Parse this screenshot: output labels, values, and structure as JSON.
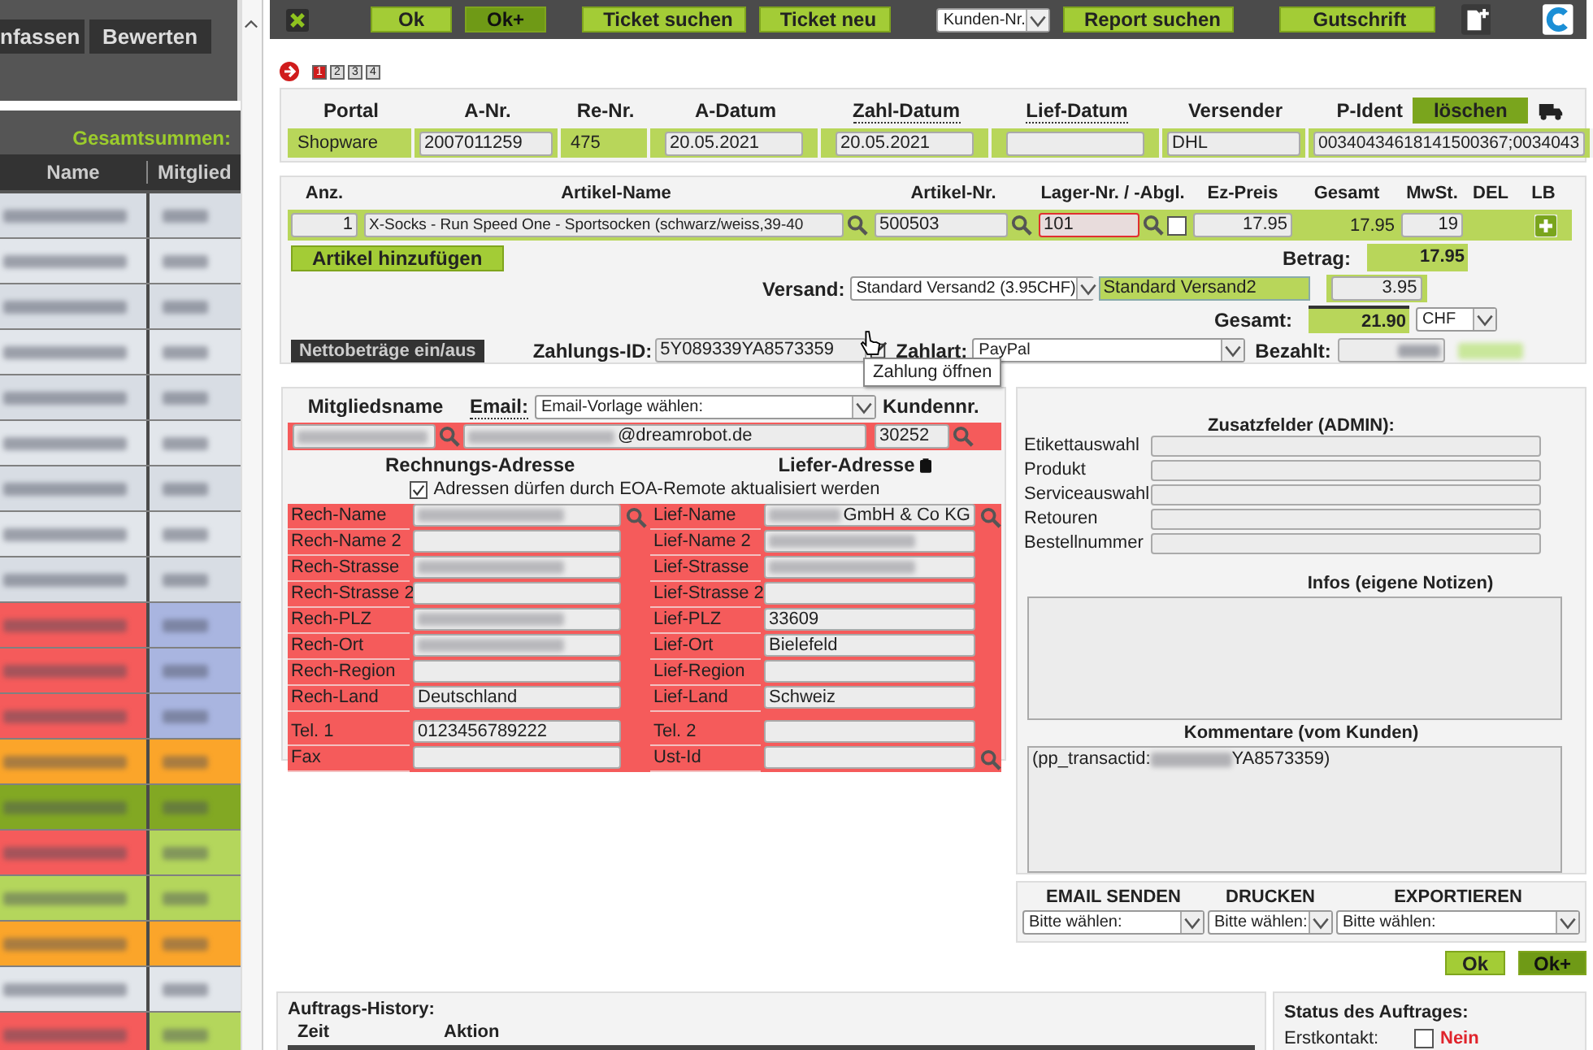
{
  "sidebar": {
    "tabs": [
      {
        "label": "nfassen",
        "selected": false
      },
      {
        "label": "Bewerten",
        "selected": false
      }
    ],
    "summary_label": "Gesamtsummen:",
    "columns": [
      "Name",
      "Mitglied"
    ],
    "rows": [
      {
        "cells": [
          {
            "color": "#d8dde4"
          },
          {
            "color": "#d8dde4"
          }
        ]
      },
      {
        "cells": [
          {
            "color": "#e2e6eb"
          },
          {
            "color": "#e2e6eb"
          }
        ]
      },
      {
        "cells": [
          {
            "color": "#d8dde4"
          },
          {
            "color": "#d8dde4"
          }
        ]
      },
      {
        "cells": [
          {
            "color": "#e2e6eb"
          },
          {
            "color": "#e2e6eb"
          }
        ]
      },
      {
        "cells": [
          {
            "color": "#d8dde4"
          },
          {
            "color": "#d8dde4"
          }
        ]
      },
      {
        "cells": [
          {
            "color": "#e2e6eb"
          },
          {
            "color": "#e2e6eb"
          }
        ]
      },
      {
        "cells": [
          {
            "color": "#d8dde4"
          },
          {
            "color": "#d8dde4"
          }
        ]
      },
      {
        "cells": [
          {
            "color": "#e2e6eb"
          },
          {
            "color": "#e2e6eb"
          }
        ]
      },
      {
        "cells": [
          {
            "color": "#d8dde4"
          },
          {
            "color": "#d8dde4"
          }
        ]
      },
      {
        "cells": [
          {
            "color": "#f55b5b"
          },
          {
            "color": "#a9b5e0"
          }
        ]
      },
      {
        "cells": [
          {
            "color": "#f55b5b"
          },
          {
            "color": "#a9b5e0"
          }
        ]
      },
      {
        "cells": [
          {
            "color": "#f55b5b"
          },
          {
            "color": "#a9b5e0"
          }
        ]
      },
      {
        "cells": [
          {
            "color": "#fba52a"
          },
          {
            "color": "#fba52a"
          }
        ]
      },
      {
        "cells": [
          {
            "color": "#82a823"
          },
          {
            "color": "#82a823"
          }
        ]
      },
      {
        "cells": [
          {
            "color": "#f55b5b"
          },
          {
            "color": "#b4d65c"
          }
        ]
      },
      {
        "cells": [
          {
            "color": "#b4d65c"
          },
          {
            "color": "#b4d65c"
          }
        ]
      },
      {
        "cells": [
          {
            "color": "#fba52a"
          },
          {
            "color": "#fba52a"
          }
        ]
      },
      {
        "cells": [
          {
            "color": "#e2e6eb"
          },
          {
            "color": "#e2e6eb"
          }
        ]
      },
      {
        "cells": [
          {
            "color": "#f55b5b"
          },
          {
            "color": "#b4d65c"
          }
        ]
      }
    ]
  },
  "toolbar": {
    "items": [
      {
        "kind": "close"
      },
      {
        "kind": "button",
        "label": "Ok"
      },
      {
        "kind": "strong",
        "label": "Ok+"
      },
      {
        "kind": "button",
        "label": "Ticket suchen"
      },
      {
        "kind": "button",
        "label": "Ticket neu"
      },
      {
        "kind": "select",
        "label": "Kunden-Nr."
      },
      {
        "kind": "button",
        "label": "Report suchen"
      },
      {
        "kind": "button",
        "label": "Gutschrift"
      }
    ]
  },
  "pages": [
    {
      "label": "1",
      "selected": true
    },
    {
      "label": "2",
      "selected": false
    },
    {
      "label": "3",
      "selected": false
    },
    {
      "label": "4",
      "selected": false
    }
  ],
  "order": {
    "columns": [
      {
        "label": "Portal",
        "hint": false
      },
      {
        "label": "A-Nr.",
        "hint": false
      },
      {
        "label": "Re-Nr.",
        "hint": false
      },
      {
        "label": "A-Datum",
        "hint": false
      },
      {
        "label": "Zahl-Datum",
        "hint": true
      },
      {
        "label": "Lief-Datum",
        "hint": true
      },
      {
        "label": "Versender",
        "hint": false
      }
    ],
    "pident_label": "P-Ident",
    "delete_button": "löschen",
    "values": [
      {
        "kind": "text",
        "value": "Shopware"
      },
      {
        "kind": "field",
        "value": "2007011259"
      },
      {
        "kind": "text",
        "value": "475"
      },
      {
        "kind": "field",
        "value": "20.05.2021"
      },
      {
        "kind": "field",
        "value": "20.05.2021"
      },
      {
        "kind": "field"
      },
      {
        "kind": "field",
        "value": "DHL"
      },
      {
        "kind": "field",
        "value": "00340434618141500367;0034043"
      }
    ]
  },
  "items": {
    "columns": [
      "Anz.",
      "Artikel-Name",
      "Artikel-Nr.",
      "Lager-Nr. / -Abgl.",
      "Ez-Preis",
      "Gesamt",
      "MwSt.",
      "DEL",
      "LB"
    ],
    "row": {
      "qty": "1",
      "name": "X-Socks - Run Speed One - Sportsocken (schwarz/weiss,39-40",
      "number": "500503",
      "stock": "101",
      "stock_error": true,
      "sync_checked": false,
      "unit_price": "17.95",
      "total": "17.95",
      "vat": "19"
    },
    "add_button": "Artikel hinzufügen"
  },
  "totals": {
    "amount_label": "Betrag:",
    "amount": "17.95",
    "shipping_label": "Versand:",
    "shipping_select": "Standard Versand2 (3.95CHF)",
    "shipping_name": "Standard Versand2",
    "shipping_cost": "3.95",
    "total_label": "Gesamt:",
    "total": "21.90",
    "currency": "CHF"
  },
  "payment": {
    "net_button": "Nettobeträge ein/aus",
    "id_label": "Zahlungs-ID:",
    "id": "5Y089339YA8573359",
    "type_label": "Zahlart:",
    "type": "PayPal",
    "paid_label": "Bezahlt:",
    "tooltip": "Zahlung öffnen"
  },
  "customer": {
    "member_label": "Mitgliedsname",
    "email_label": "Email:",
    "email_template": "Email-Vorlage wählen:",
    "customer_no_label": "Kundennr.",
    "email_domain": "@dreamrobot.de",
    "customer_no": "30252",
    "billing_title": "Rechnungs-Adresse",
    "shipping_title": "Liefer-Adresse",
    "remote_update": {
      "label": "Adressen dürfen durch EOA-Remote aktualisiert werden",
      "checked": true
    },
    "address_rows": [
      {
        "left": {
          "label": "Rech-Name",
          "redacted": true,
          "search": true
        },
        "right": {
          "label": "Lief-Name",
          "redacted": true,
          "value": "GmbH & Co KG",
          "search": true
        }
      },
      {
        "left": {
          "label": "Rech-Name 2"
        },
        "right": {
          "label": "Lief-Name 2",
          "redacted": true
        }
      },
      {
        "left": {
          "label": "Rech-Strasse",
          "redacted": true
        },
        "right": {
          "label": "Lief-Strasse",
          "redacted": true
        }
      },
      {
        "left": {
          "label": "Rech-Strasse 2"
        },
        "right": {
          "label": "Lief-Strasse 2"
        }
      },
      {
        "left": {
          "label": "Rech-PLZ",
          "redacted": true
        },
        "right": {
          "label": "Lief-PLZ",
          "value": "33609"
        }
      },
      {
        "left": {
          "label": "Rech-Ort",
          "redacted": true
        },
        "right": {
          "label": "Lief-Ort",
          "value": "Bielefeld"
        }
      },
      {
        "left": {
          "label": "Rech-Region"
        },
        "right": {
          "label": "Lief-Region"
        }
      },
      {
        "left": {
          "label": "Rech-Land",
          "value": "Deutschland"
        },
        "right": {
          "label": "Lief-Land",
          "value": "Schweiz"
        }
      }
    ],
    "contact_rows": [
      {
        "left": {
          "label": "Tel. 1",
          "value": "0123456789222"
        },
        "right": {
          "label": "Tel. 2"
        }
      },
      {
        "left": {
          "label": "Fax"
        },
        "right": {
          "label": "Ust-Id",
          "search": true
        }
      }
    ]
  },
  "extras": {
    "title": "Zusatzfelder (ADMIN):",
    "fields": [
      "Etikettauswahl",
      "Produkt",
      "Serviceauswahl",
      "Retouren",
      "Bestellnummer"
    ],
    "notes_title": "Infos (eigene Notizen)",
    "comments_title": "Kommentare (vom Kunden)",
    "comment_prefix": "(pp_transactid:",
    "comment_suffix": "YA8573359)"
  },
  "actions": {
    "groups": [
      {
        "title": "EMAIL SENDEN",
        "select": "Bitte wählen:"
      },
      {
        "title": "DRUCKEN",
        "select": "Bitte wählen:"
      },
      {
        "title": "EXPORTIEREN",
        "select": "Bitte wählen:"
      }
    ],
    "buttons": [
      {
        "kind": "button",
        "label": "Ok"
      },
      {
        "kind": "strong",
        "label": "Ok+"
      }
    ]
  },
  "history": {
    "title": "Auftrags-History:",
    "columns": [
      "Zeit",
      "Aktion"
    ]
  },
  "status": {
    "title": "Status des Auftrages:",
    "rows": [
      {
        "label": "Erstkontakt:",
        "checked": false,
        "value": "Nein"
      }
    ]
  }
}
